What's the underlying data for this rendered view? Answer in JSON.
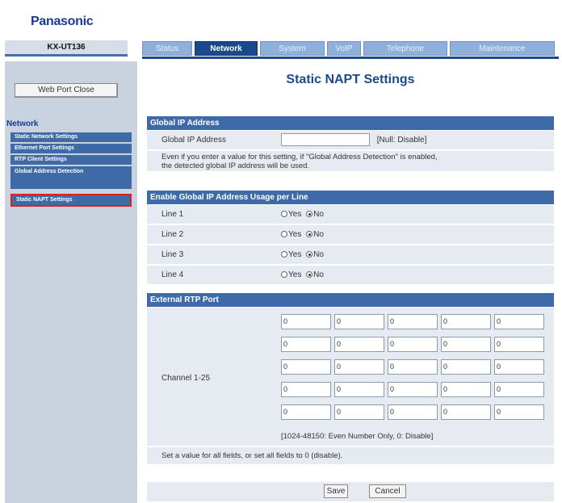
{
  "header": {
    "brand": "Panasonic",
    "model": "KX-UT136"
  },
  "tabs": [
    {
      "label": "Status",
      "active": false
    },
    {
      "label": "Network",
      "active": true
    },
    {
      "label": "System",
      "active": false
    },
    {
      "label": "VoIP",
      "active": false
    },
    {
      "label": "Telephone",
      "active": false
    },
    {
      "label": "Maintenance",
      "active": false
    }
  ],
  "sidebar": {
    "webport_close": "Web Port Close",
    "section_title": "Network",
    "items": [
      {
        "label": "Static Network Settings"
      },
      {
        "label": "Ethernet Port Settings"
      },
      {
        "label": "RTP Client Settings"
      },
      {
        "label": "Global Address Detection"
      },
      {
        "label": "Static NAPT Settings"
      }
    ]
  },
  "main": {
    "title": "Static NAPT Settings",
    "global_ip": {
      "header": "Global IP Address",
      "label": "Global IP Address",
      "value": "",
      "hint": "[Null: Disable]",
      "note_line1": "Even if you enter a value for this setting, if \"Global Address Detection\" is enabled,",
      "note_line2": "the detected global IP address will be used."
    },
    "usage": {
      "header": "Enable Global IP Address Usage per Line",
      "yes_label": "Yes",
      "no_label": "No",
      "lines": [
        {
          "label": "Line 1",
          "selected": "No"
        },
        {
          "label": "Line 2",
          "selected": "No"
        },
        {
          "label": "Line 3",
          "selected": "No"
        },
        {
          "label": "Line 4",
          "selected": "No"
        }
      ]
    },
    "rtp": {
      "header": "External RTP Port",
      "channel_label": "Channel 1-25",
      "rows": [
        [
          "0",
          "0",
          "0",
          "0",
          "0"
        ],
        [
          "0",
          "0",
          "0",
          "0",
          "0"
        ],
        [
          "0",
          "0",
          "0",
          "0",
          "0"
        ],
        [
          "0",
          "0",
          "0",
          "0",
          "0"
        ],
        [
          "0",
          "0",
          "0",
          "0",
          "0"
        ]
      ],
      "range_note": "[1024-48150: Even Number Only, 0: Disable]",
      "footnote": "Set a value for all fields, or set all fields to 0 (disable)."
    },
    "buttons": {
      "save": "Save",
      "cancel": "Cancel"
    }
  }
}
